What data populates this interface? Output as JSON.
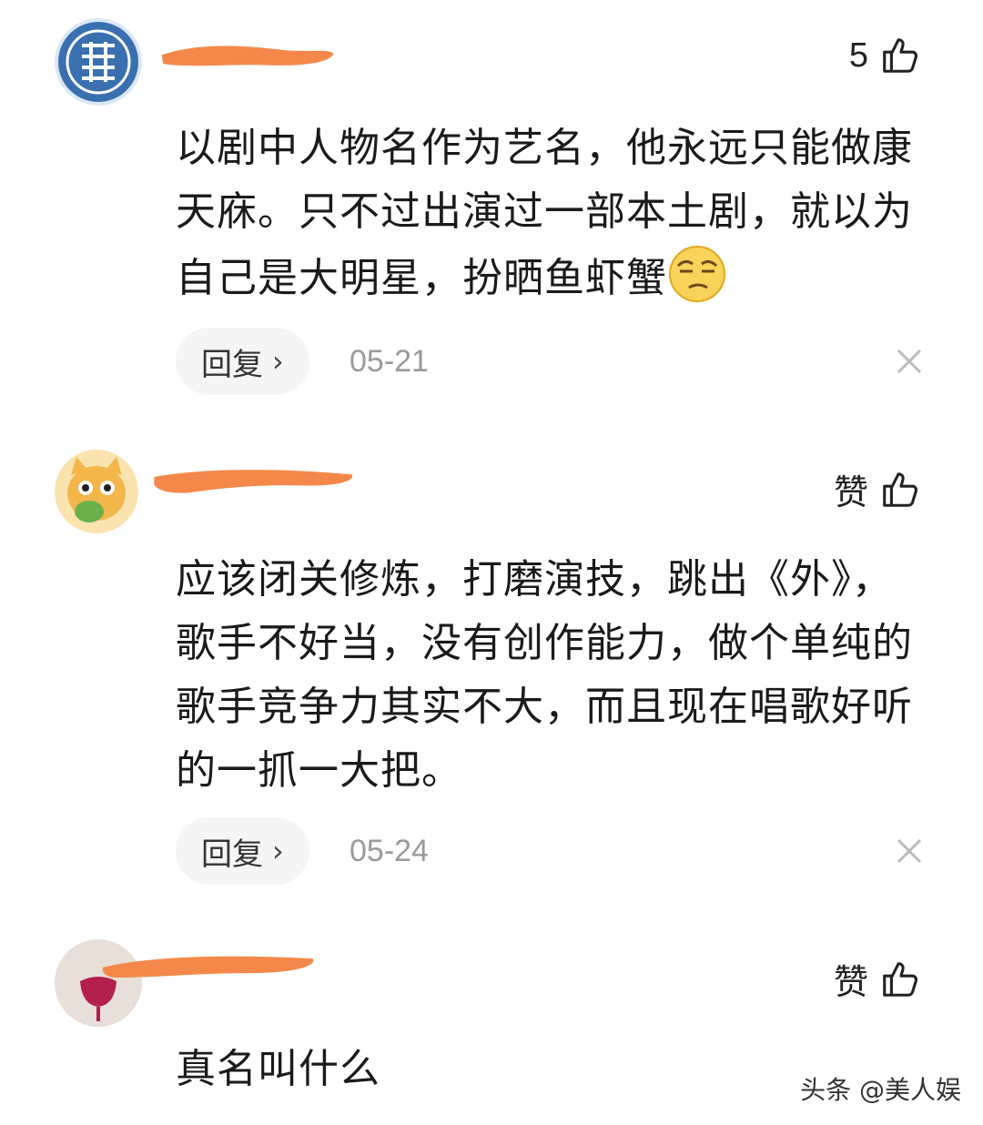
{
  "comments": [
    {
      "likes_label": "5",
      "body": "以剧中人物名作为艺名，他永远只能做康天庥。只不过出演过一部本土剧，就以为自己是大明星，扮晒鱼虾蟹",
      "emoji": "smug-face-emoji",
      "reply_label": "回复",
      "date": "05-21"
    },
    {
      "likes_label": "赞",
      "body": "应该闭关修炼，打磨演技，跳出《外》，歌手不好当，没有创作能力，做个单纯的歌手竞争力其实不大，而且现在唱歌好听的一抓一大把。",
      "reply_label": "回复",
      "date": "05-24"
    },
    {
      "likes_label": "赞",
      "body": "真名叫什么"
    }
  ],
  "watermark": "头条 @美人娱",
  "colors": {
    "redaction": "#f4884a",
    "avatar1": "#3a6fb0",
    "avatar2": "#f2b64a"
  }
}
